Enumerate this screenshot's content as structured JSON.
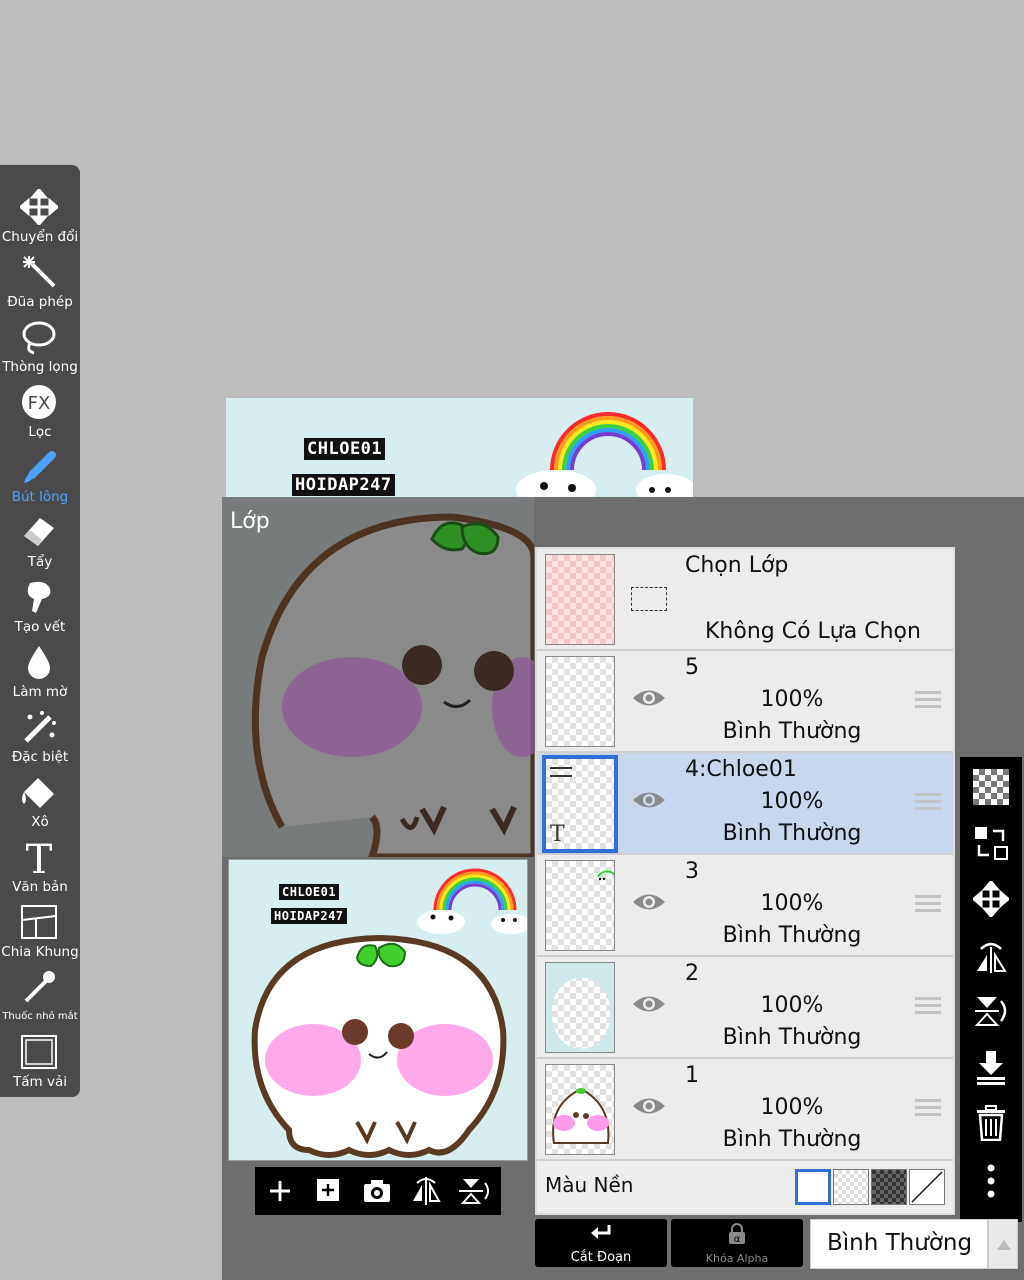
{
  "tools": [
    {
      "label": "Chuyển đổi",
      "icon": "move-arrows-icon"
    },
    {
      "label": "Đũa phép",
      "icon": "magic-wand-icon"
    },
    {
      "label": "Thòng lọng",
      "icon": "lasso-icon"
    },
    {
      "label": "Lọc",
      "icon": "fx-filter-icon",
      "icon_text": "FX"
    },
    {
      "label": "Bút lông",
      "icon": "brush-icon",
      "active": true
    },
    {
      "label": "Tẩy",
      "icon": "eraser-icon"
    },
    {
      "label": "Tạo vết",
      "icon": "smudge-icon"
    },
    {
      "label": "Làm mờ",
      "icon": "blur-drop-icon"
    },
    {
      "label": "Đặc biệt",
      "icon": "special-brush-icon"
    },
    {
      "label": "Xô",
      "icon": "bucket-icon"
    },
    {
      "label": "Văn bản",
      "icon": "text-icon",
      "icon_text": "T"
    },
    {
      "label": "Chia Khung",
      "icon": "frame-divider-icon"
    },
    {
      "label": "Thuốc nhỏ mắt",
      "icon": "eyedropper-icon"
    },
    {
      "label": "Tấm vải",
      "icon": "canvas-icon"
    }
  ],
  "canvas": {
    "tag1": "CHLOE01",
    "tag2": "HOIDAP247"
  },
  "panel": {
    "title": "Lớp",
    "selection_row": {
      "title": "Chọn Lớp",
      "subtitle": "Không Có Lựa Chọn"
    },
    "layers": [
      {
        "name": "5",
        "opacity": "100%",
        "mode": "Bình Thường",
        "selected": false
      },
      {
        "name": "4:Chloe01",
        "opacity": "100%",
        "mode": "Bình Thường",
        "selected": true
      },
      {
        "name": "3",
        "opacity": "100%",
        "mode": "Bình Thường",
        "selected": false
      },
      {
        "name": "2",
        "opacity": "100%",
        "mode": "Bình Thường",
        "selected": false
      },
      {
        "name": "1",
        "opacity": "100%",
        "mode": "Bình Thường",
        "selected": false
      }
    ],
    "background_label": "Màu Nền",
    "thumb_text_icon": "T"
  },
  "bottom": {
    "clip_label": "Cắt Đoạn",
    "alpha_label": "Khóa Alpha",
    "alpha_icon_text": "α",
    "blend_mode": "Bình Thường"
  },
  "colors": {
    "toolbar_bg": "#4a4a4a",
    "active_tool": "#4aa3ff",
    "selected_layer": "#c9d7ee",
    "selected_border": "#2f6fd6"
  }
}
